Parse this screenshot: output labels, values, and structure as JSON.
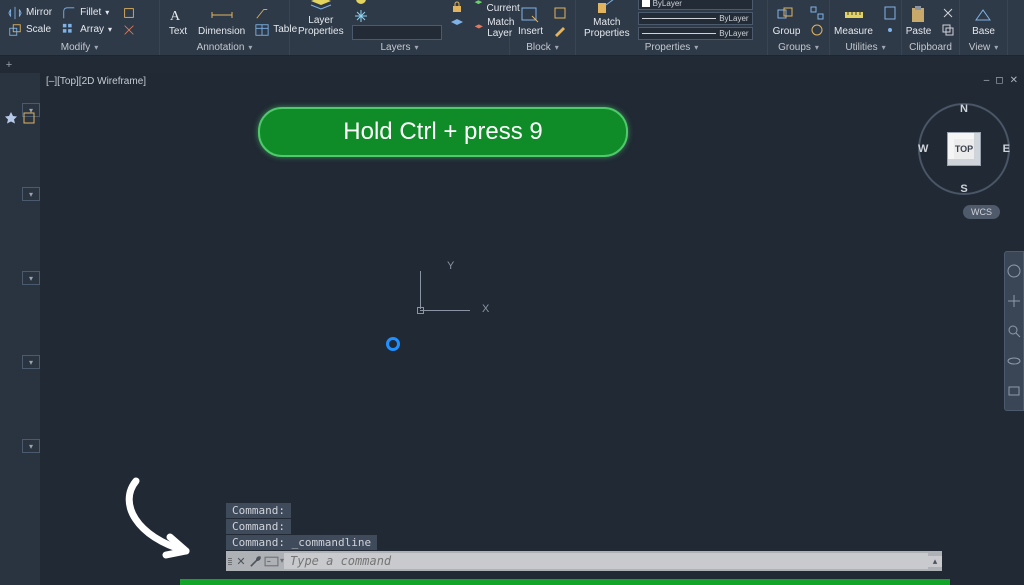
{
  "ribbon": {
    "modify": {
      "mirror": "Mirror",
      "fillet": "Fillet",
      "scale": "Scale",
      "array": "Array",
      "title": "Modify"
    },
    "annotation": {
      "text": "Text",
      "dimension": "Dimension",
      "table": "Table",
      "title": "Annotation"
    },
    "layers": {
      "layer_properties": "Layer\nProperties",
      "make_current": "Make Current",
      "match_layer": "Match Layer",
      "title": "Layers"
    },
    "block": {
      "insert": "Insert",
      "title": "Block"
    },
    "properties": {
      "match_properties": "Match\nProperties",
      "bylayer1": "ByLayer",
      "bylayer2": "ByLayer",
      "title": "Properties"
    },
    "groups": {
      "group": "Group",
      "title": "Groups"
    },
    "utilities": {
      "measure": "Measure",
      "title": "Utilities"
    },
    "clipboard": {
      "paste": "Paste",
      "title": "Clipboard"
    },
    "view": {
      "base": "Base",
      "title": "View"
    }
  },
  "viewport": {
    "label": "[–][Top][2D Wireframe]",
    "ucs_y": "Y",
    "ucs_x": "X"
  },
  "viewcube": {
    "n": "N",
    "s": "S",
    "e": "E",
    "w": "W",
    "face": "TOP",
    "wcs": "WCS"
  },
  "overlay": {
    "hint": "Hold Ctrl + press 9"
  },
  "command": {
    "hist1": "Command:",
    "hist2": "Command:",
    "hist3": "Command: _commandline",
    "placeholder": "Type a command",
    "prompt_caret": "▾"
  }
}
